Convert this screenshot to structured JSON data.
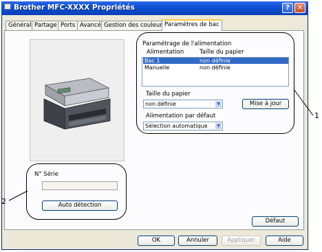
{
  "window": {
    "title": "Brother MFC-XXXX Propriétés"
  },
  "tabs": [
    {
      "label": "Général"
    },
    {
      "label": "Partage"
    },
    {
      "label": "Ports"
    },
    {
      "label": "Avancé"
    },
    {
      "label": "Gestion des couleurs"
    },
    {
      "label": "Paramètres de bac"
    }
  ],
  "tray_settings": {
    "group_label": "Paramétrage de l'alimentation",
    "col_source": "Alimentation",
    "col_size": "Taille du papier",
    "rows": [
      {
        "source": "Bac 1",
        "size": "non définie"
      },
      {
        "source": "Manuelle",
        "size": "non définie"
      }
    ],
    "paper_size_label": "Taille du papier",
    "paper_size_value": "non définie",
    "update_button": "Mise à jour",
    "default_source_label": "Alimentation par défaut",
    "default_source_value": "Sélection automatique"
  },
  "serial": {
    "label": "N° Série",
    "value": "",
    "auto_detect_button": "Auto détection"
  },
  "buttons": {
    "default": "Défaut",
    "ok": "OK",
    "cancel": "Annuler",
    "apply": "Appliquer",
    "help": "Aide"
  },
  "callouts": {
    "one": "1",
    "two": "2"
  }
}
